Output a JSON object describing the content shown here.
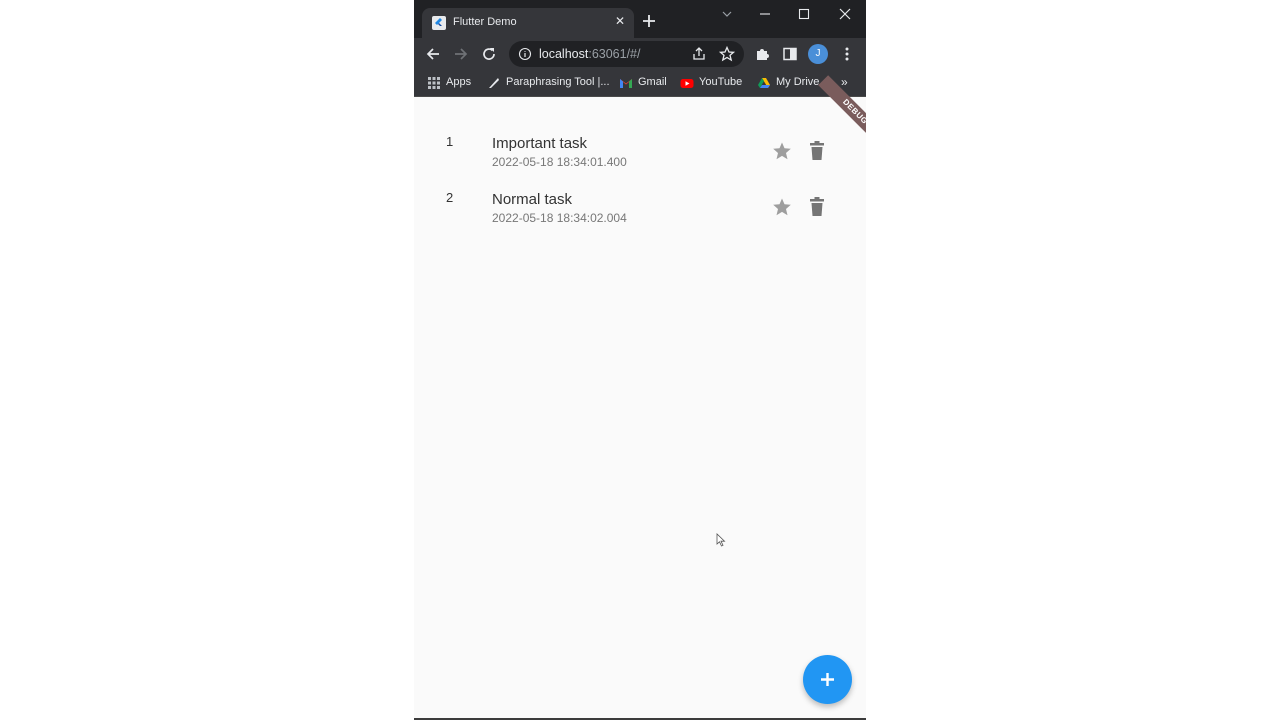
{
  "browser": {
    "tab_title": "Flutter Demo",
    "url_host": "localhost",
    "url_rest": ":63061/#/",
    "avatar_initial": "J",
    "bookmarks": [
      {
        "label": "Apps",
        "icon": "apps-grid-icon"
      },
      {
        "label": "Paraphrasing Tool |...",
        "icon": "quill-icon"
      },
      {
        "label": "Gmail",
        "icon": "gmail-icon"
      },
      {
        "label": "YouTube",
        "icon": "youtube-icon"
      },
      {
        "label": "My Drive",
        "icon": "drive-icon"
      }
    ],
    "bookmarks_more": "»"
  },
  "app": {
    "debug_banner": "DEBUG",
    "tasks": [
      {
        "index": "1",
        "title": "Important task",
        "date": "2022-05-18 18:34:01.400"
      },
      {
        "index": "2",
        "title": "Normal task",
        "date": "2022-05-18 18:34:02.004"
      }
    ],
    "fab_icon": "plus-icon"
  },
  "colors": {
    "accent": "#2196f3",
    "browser_frame": "#202124",
    "toolbar": "#35363a",
    "icon_grey": "#9e9e9e"
  }
}
